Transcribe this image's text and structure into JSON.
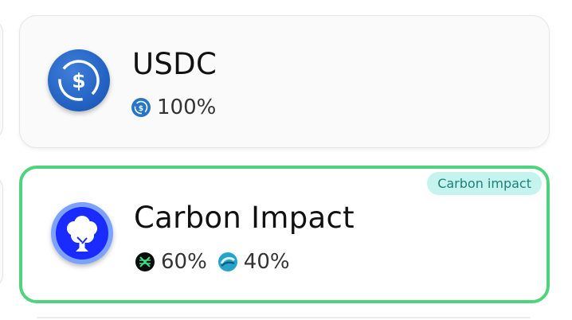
{
  "cards": [
    {
      "title": "USDC",
      "icon": "usdc-coin-icon",
      "allocations": [
        {
          "icon": "usdc-icon",
          "percent": "100%"
        }
      ]
    },
    {
      "title": "Carbon Impact",
      "icon": "tree-icon",
      "badge": "Carbon impact",
      "selected": true,
      "allocations": [
        {
          "icon": "carbon-token-icon",
          "percent": "60%"
        },
        {
          "icon": "swirl-token-icon",
          "percent": "40%"
        }
      ]
    }
  ],
  "colors": {
    "selected_border": "#4fd37e",
    "badge_bg": "#c5f3ee",
    "badge_text": "#1f7f7a",
    "usdc_blue": "#2775ca",
    "tree_blue": "#1a2bff"
  }
}
